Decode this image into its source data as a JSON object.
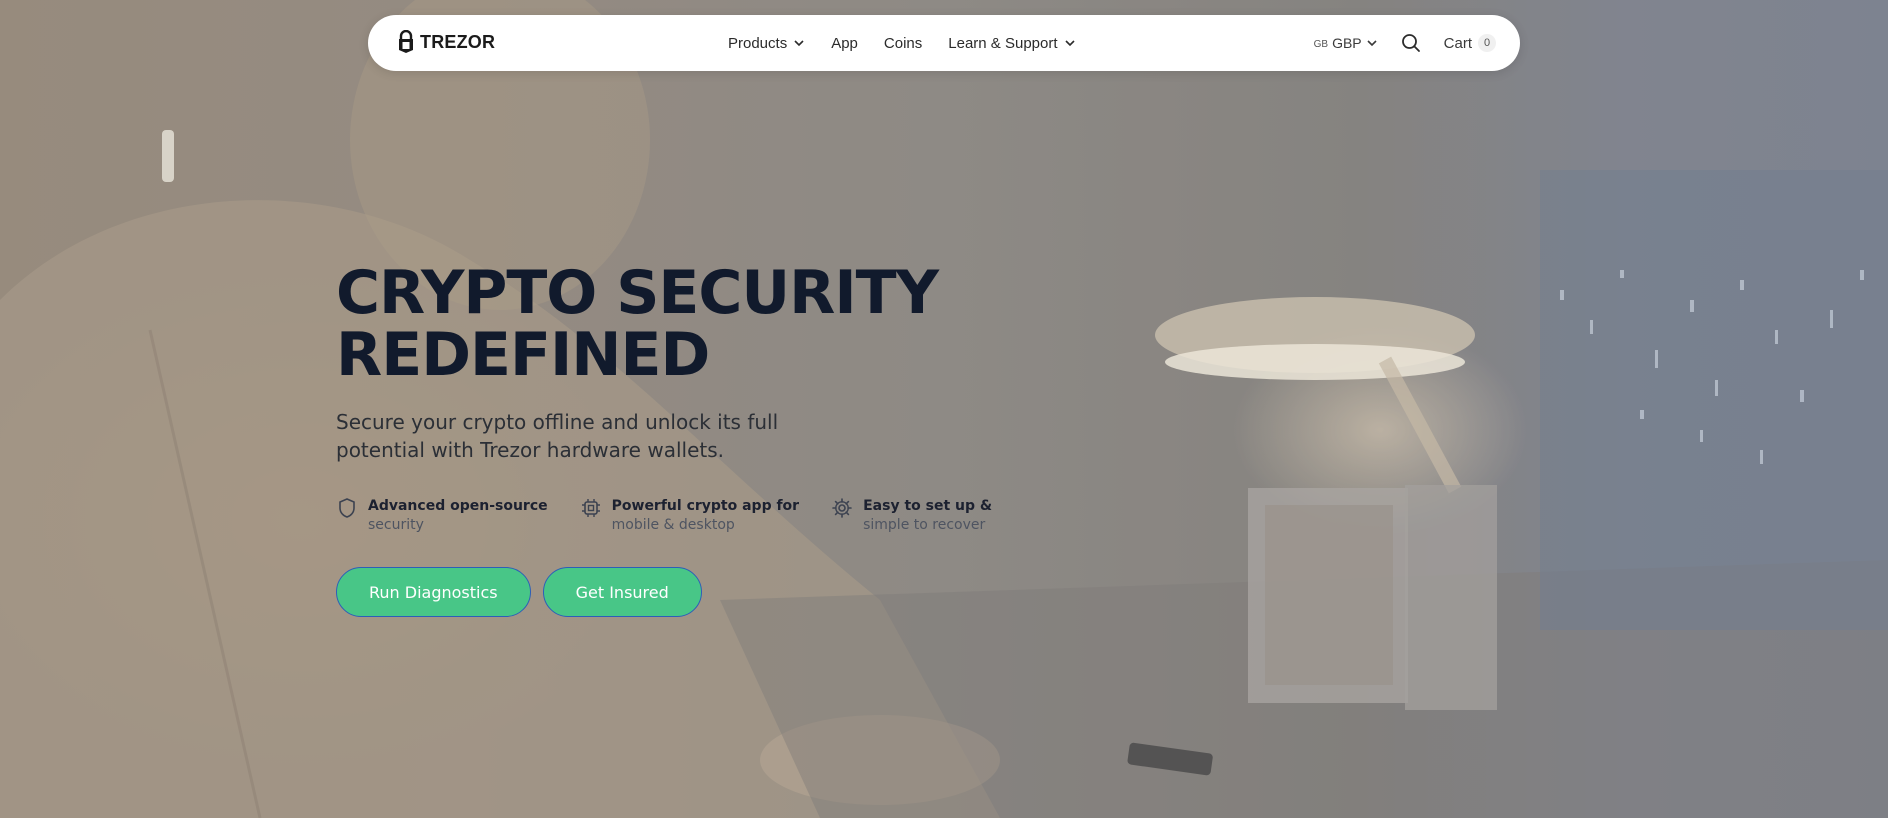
{
  "nav": {
    "logo_text": "TREZOR",
    "links": [
      {
        "label": "Products"
      },
      {
        "label": "App"
      },
      {
        "label": "Coins"
      },
      {
        "label": "Learn & Support"
      }
    ],
    "currency_flag": "GB",
    "currency_label": "GBP",
    "cart_label": "Cart",
    "cart_count": "0"
  },
  "hero": {
    "title_line1": "CRYPTO SECURITY",
    "title_line2": "REDEFINED",
    "subtitle": "Secure your crypto offline and unlock its full potential with Trezor hardware wallets.",
    "features": [
      {
        "title": "Advanced open-source",
        "desc": "security",
        "icon": "shield-icon"
      },
      {
        "title": "Powerful crypto app for",
        "desc": "mobile & desktop",
        "icon": "chip-icon"
      },
      {
        "title": "Easy to set up &",
        "desc": "simple to recover",
        "icon": "gear-icon"
      }
    ],
    "buttons": {
      "primary": "Run Diagnostics",
      "secondary": "Get Insured"
    }
  },
  "colors": {
    "cta_fill": "#48c687",
    "cta_border": "#2c5fb8",
    "title_text": "#111a2c"
  }
}
